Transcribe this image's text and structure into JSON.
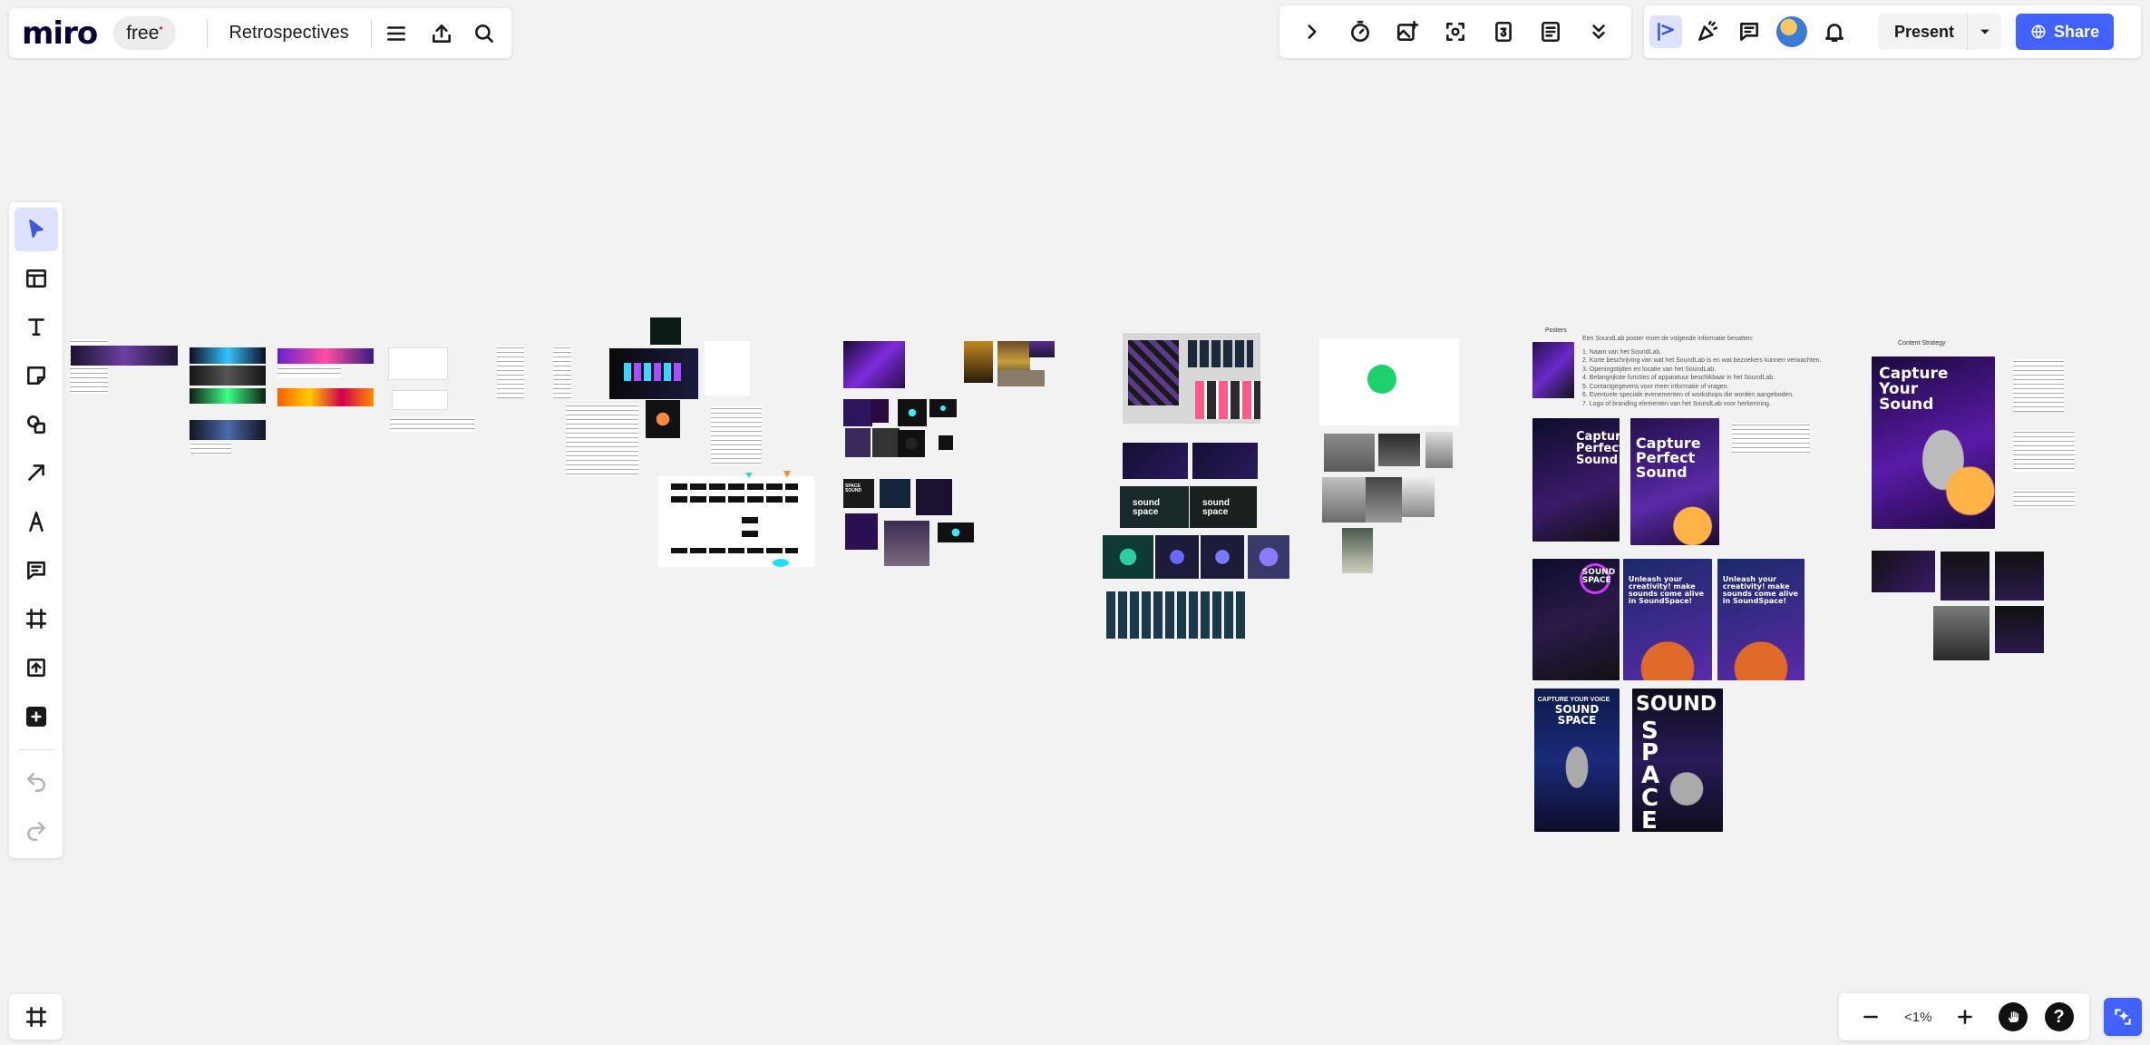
{
  "app": {
    "logo": "miro",
    "plan": "free",
    "plan_mark": "•",
    "board_title": "Retrospectives"
  },
  "toolbar_right": {
    "present_label": "Present",
    "share_label": "Share"
  },
  "zoom": {
    "value": "<1%",
    "help": "?"
  },
  "canvas": {
    "posters_heading": "Posters",
    "posters_intro": "Een SoundLab poster moet de volgende informatie bevatten:",
    "posters_list": [
      "1. Naam van het SoundLab.",
      "2. Korte beschrijving van wat het SoundLab is en wat bezoekers kunnen verwachten.",
      "3. Openingstijden en locatie van het SoundLab.",
      "4. Belangrijkste functies of apparatuur beschikbaar in het SoundLab.",
      "5. Contactgegevens voor meer informatie of vragen.",
      "6. Eventuele speciale evenementen of workshops die worden aangeboden.",
      "7. Logo of branding elementen van het SoundLab voor herkenning."
    ],
    "content_strategy_heading": "Content Strategy",
    "poster_capture_1": "Capture Perfect Sound",
    "poster_capture_2": "Capture Perfect Sound",
    "poster_capture_your": "Capture Your Sound",
    "poster_sound_space": "SOUND SPACE",
    "poster_unleash_1": "Unleash your creativity! make sounds come alive in SoundSpace!",
    "poster_unleash_2": "Unleash your creativity! make sounds come alive in SoundSpace!",
    "poster_voice_kicker": "CAPTURE YOUR VOICE",
    "poster_voice_title": "SOUND SPACE",
    "poster_big_sound": "SOUND",
    "poster_big_space": "SPACE",
    "logo_sound_space_1": "sound space",
    "logo_sound_space_2": "sound space",
    "space_sound_tile": "SPACE SOUND"
  },
  "colors": {
    "accent": "#4262ff",
    "active_tool_bg": "#dde3ff",
    "canvas_bg": "#f2f2f2",
    "plan_mark": "#e0245e"
  },
  "icons": {
    "top_mid": [
      "chevron-right-icon",
      "timer-icon",
      "add-image-icon",
      "focus-icon",
      "calendar-icon",
      "notes-icon",
      "chevron-double-down-icon"
    ],
    "top_right": [
      "reactions-filter-icon",
      "celebrate-icon",
      "comment-icon",
      "avatar",
      "bell-icon"
    ],
    "left": [
      "select-icon",
      "templates-icon",
      "text-icon",
      "sticky-note-icon",
      "shapes-icon",
      "arrow-icon",
      "pen-icon",
      "comment-icon",
      "frame-icon",
      "upload-icon",
      "plus-icon",
      "undo-icon",
      "redo-icon"
    ]
  }
}
